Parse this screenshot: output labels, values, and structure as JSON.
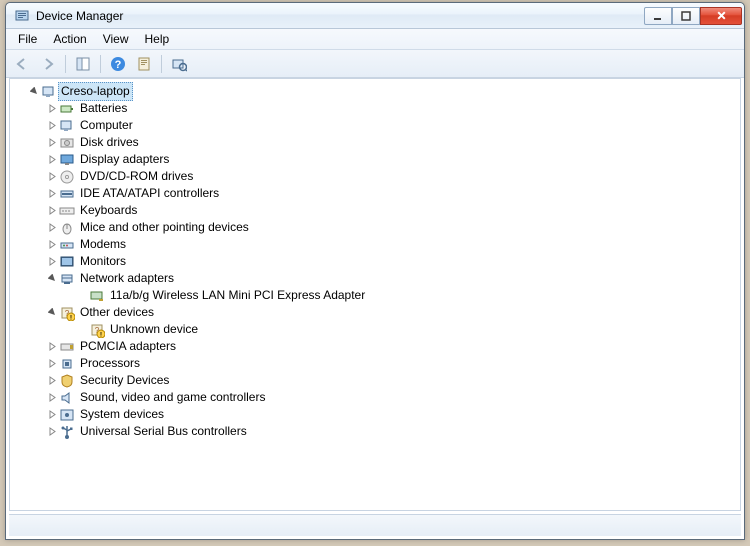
{
  "window": {
    "title": "Device Manager"
  },
  "menu": {
    "file": "File",
    "action": "Action",
    "view": "View",
    "help": "Help"
  },
  "tree": {
    "root": "Creso-laptop",
    "items": [
      {
        "label": "Batteries",
        "icon": "battery"
      },
      {
        "label": "Computer",
        "icon": "computer"
      },
      {
        "label": "Disk drives",
        "icon": "disk"
      },
      {
        "label": "Display adapters",
        "icon": "display"
      },
      {
        "label": "DVD/CD-ROM drives",
        "icon": "dvd"
      },
      {
        "label": "IDE ATA/ATAPI controllers",
        "icon": "ide"
      },
      {
        "label": "Keyboards",
        "icon": "keyboard"
      },
      {
        "label": "Mice and other pointing devices",
        "icon": "mouse"
      },
      {
        "label": "Modems",
        "icon": "modem"
      },
      {
        "label": "Monitors",
        "icon": "monitor"
      },
      {
        "label": "Network adapters",
        "icon": "network",
        "expanded": true,
        "children": [
          {
            "label": "11a/b/g Wireless LAN Mini PCI Express Adapter",
            "icon": "nic"
          }
        ]
      },
      {
        "label": "Other devices",
        "icon": "other",
        "expanded": true,
        "warn": true,
        "children": [
          {
            "label": "Unknown device",
            "icon": "unknown",
            "warn": true
          }
        ]
      },
      {
        "label": "PCMCIA adapters",
        "icon": "pcmcia"
      },
      {
        "label": "Processors",
        "icon": "cpu"
      },
      {
        "label": "Security Devices",
        "icon": "security"
      },
      {
        "label": "Sound, video and game controllers",
        "icon": "sound"
      },
      {
        "label": "System devices",
        "icon": "system"
      },
      {
        "label": "Universal Serial Bus controllers",
        "icon": "usb"
      }
    ]
  }
}
